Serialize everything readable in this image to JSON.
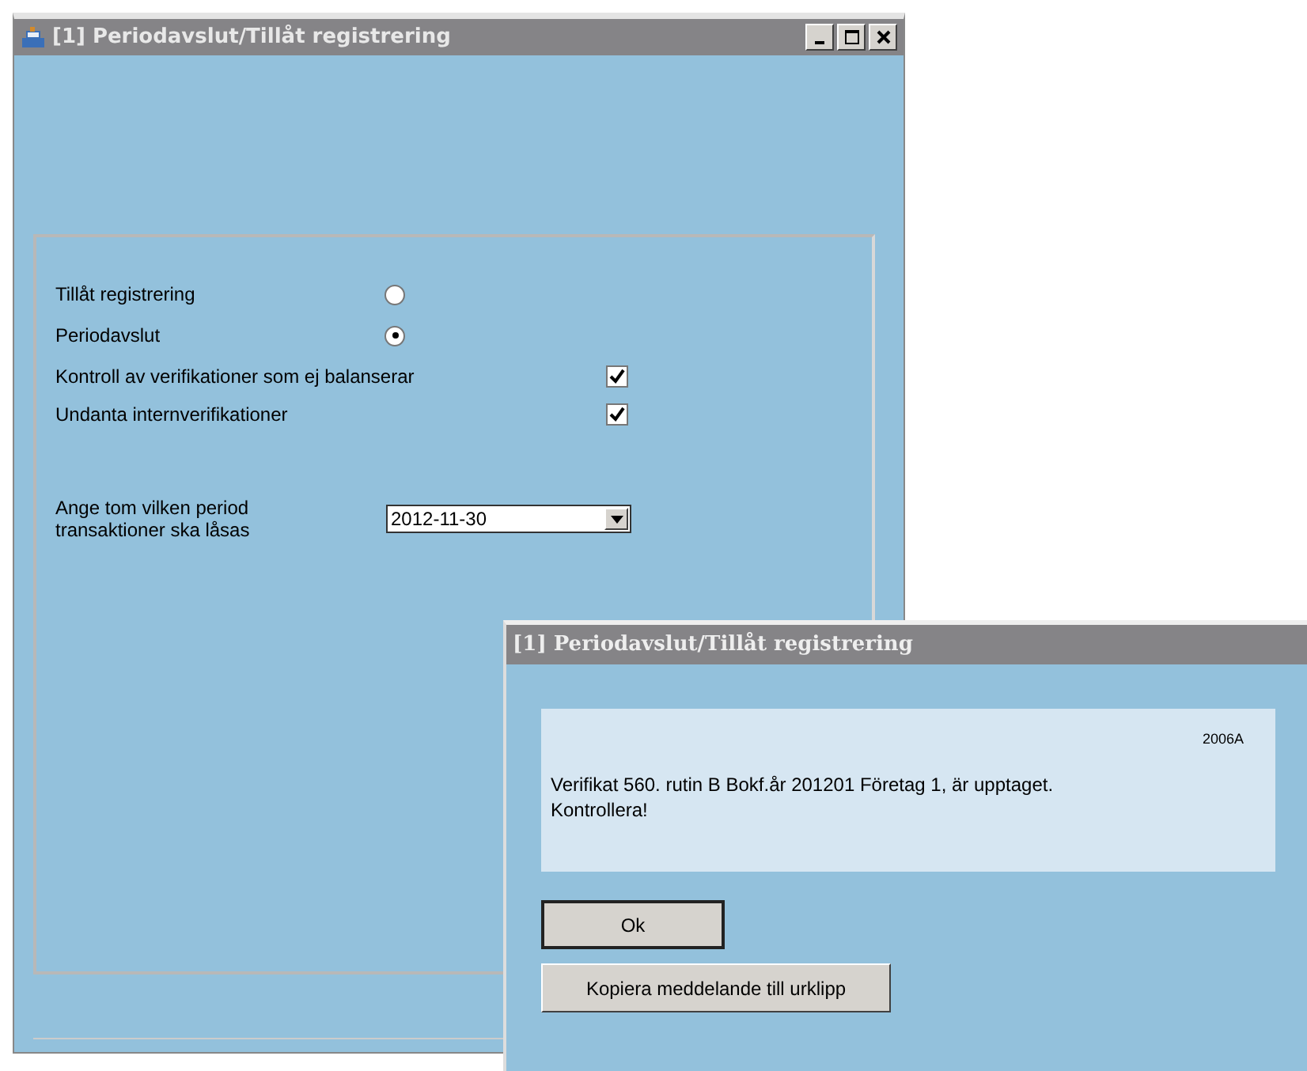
{
  "window": {
    "title": "[1]  Periodavslut/Tillåt registrering"
  },
  "options": [
    {
      "kind": "radio",
      "label": "Tillåt registrering",
      "selected": false
    },
    {
      "kind": "radio",
      "label": "Periodavslut",
      "selected": true
    },
    {
      "kind": "checkbox",
      "label": "Kontroll av verifikationer som ej balanserar",
      "checked": true
    },
    {
      "kind": "checkbox",
      "label": "Undanta internverifikationer",
      "checked": true
    }
  ],
  "period": {
    "label_lines": [
      "Ange tom vilken period",
      "transaktioner ska låsas"
    ],
    "value": "2012-11-30"
  },
  "dialog": {
    "title": "[1]  Periodavslut/Tillåt registrering",
    "code": "2006A",
    "message_lines": [
      "Verifikat 560. rutin B Bokf.år 201201 Företag 1, är upptaget.",
      "Kontrollera!"
    ],
    "buttons": [
      "Ok",
      "Kopiera meddelande till urklipp"
    ]
  }
}
